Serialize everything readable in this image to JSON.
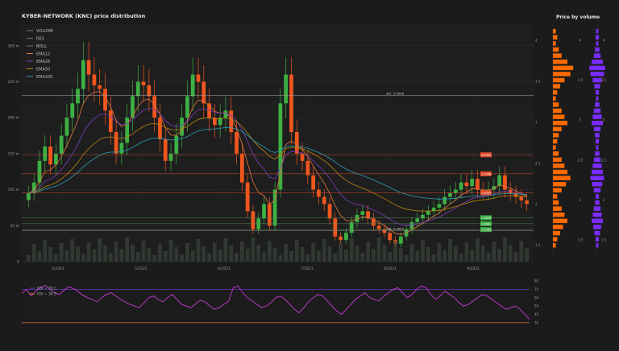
{
  "title": "KYBER-NETWORK (KNC) price distribution",
  "profile_title": "Price by volume",
  "colors": {
    "bg": "#1b1b1b",
    "up": "#3cb043",
    "down": "#f0561d",
    "ema12": "#e8743b",
    "ema26": "#7b3fbf",
    "ema50": "#b8860b",
    "ema200": "#2a9fb0",
    "rsi": "#c83ad6",
    "profile_left": "#ff6a00",
    "profile_right": "#7a2cff",
    "bars_label": "#3cb043",
    "level_red": "#e04a2a"
  },
  "chart_data": [
    {
      "type": "candlestick",
      "name": "price",
      "y_ticks": [
        "300 m",
        "250 m",
        "200 m",
        "150 m",
        "100 m",
        "50 m",
        "0"
      ],
      "y_tick_values": [
        300,
        250,
        200,
        150,
        100,
        50,
        0
      ],
      "ylim": [
        0,
        330
      ],
      "x_ticks": [
        "4/2021",
        "5/2021",
        "6/2021",
        "7/2021",
        "8/2021",
        "9/2021"
      ],
      "legend": [
        "VOLUME",
        "RES",
        "BOLL",
        "EMA12",
        "EMA26",
        "EMA50",
        "EMA200"
      ],
      "levels": [
        {
          "value": "2.9359",
          "kind": "red"
        },
        {
          "value": "2.2786",
          "kind": "red"
        },
        {
          "value": "1.9095",
          "kind": "red"
        },
        {
          "value": "1.3678",
          "kind": "green"
        },
        {
          "value": "1.2661",
          "kind": "green"
        },
        {
          "value": "1.1763",
          "kind": "green"
        }
      ],
      "ath_label": "ath: 3.5998",
      "low_label": "low: 0.9900",
      "close": [
        95,
        110,
        140,
        160,
        135,
        150,
        175,
        200,
        220,
        240,
        280,
        260,
        245,
        240,
        210,
        180,
        150,
        165,
        200,
        230,
        250,
        245,
        230,
        200,
        170,
        140,
        150,
        175,
        200,
        230,
        260,
        250,
        220,
        200,
        190,
        200,
        210,
        180,
        150,
        110,
        70,
        45,
        60,
        80,
        50,
        100,
        220,
        260,
        180,
        150,
        140,
        120,
        100,
        90,
        80,
        60,
        35,
        30,
        40,
        55,
        65,
        70,
        60,
        50,
        45,
        40,
        30,
        25,
        35,
        45,
        55,
        60,
        65,
        70,
        75,
        80,
        90,
        95,
        100,
        110,
        105,
        115,
        100,
        95,
        100,
        105,
        120,
        100,
        95,
        90,
        85,
        80
      ]
    },
    {
      "type": "bar",
      "name": "price-by-volume",
      "y_ticks": [
        "4",
        "3.5",
        "3",
        "2.5",
        "2",
        "1.5"
      ],
      "y_tick_values": [
        4,
        3.5,
        3,
        2.5,
        2,
        1.5
      ]
    },
    {
      "type": "line",
      "name": "rsi",
      "legend": [
        "RSI = 70.5",
        "RSI = 30.5"
      ],
      "y_ticks": [
        "80",
        "70",
        "60",
        "50",
        "40",
        "30"
      ],
      "y_tick_values": [
        80,
        70,
        60,
        50,
        40,
        30
      ],
      "ylim": [
        27,
        82
      ],
      "values": [
        65,
        70,
        62,
        68,
        72,
        75,
        70,
        66,
        64,
        69,
        73,
        71,
        67,
        63,
        60,
        58,
        55,
        60,
        64,
        66,
        62,
        58,
        55,
        52,
        50,
        48,
        54,
        60,
        62,
        58,
        55,
        60,
        64,
        58,
        52,
        50,
        48,
        53,
        57,
        55,
        50,
        46,
        48,
        52,
        56,
        72,
        74,
        66,
        60,
        56,
        52,
        48,
        50,
        54,
        60,
        62,
        58,
        52,
        46,
        42,
        48,
        55,
        60,
        64,
        62,
        56,
        50,
        44,
        40,
        46,
        52,
        58,
        62,
        66,
        60,
        58,
        56,
        62,
        66,
        70,
        72,
        66,
        60,
        64,
        70,
        74,
        72,
        64,
        58,
        62,
        68,
        64,
        60,
        54,
        50,
        52,
        56,
        60,
        64,
        62,
        58,
        54,
        50,
        46,
        48,
        50,
        46,
        40,
        34
      ]
    }
  ]
}
